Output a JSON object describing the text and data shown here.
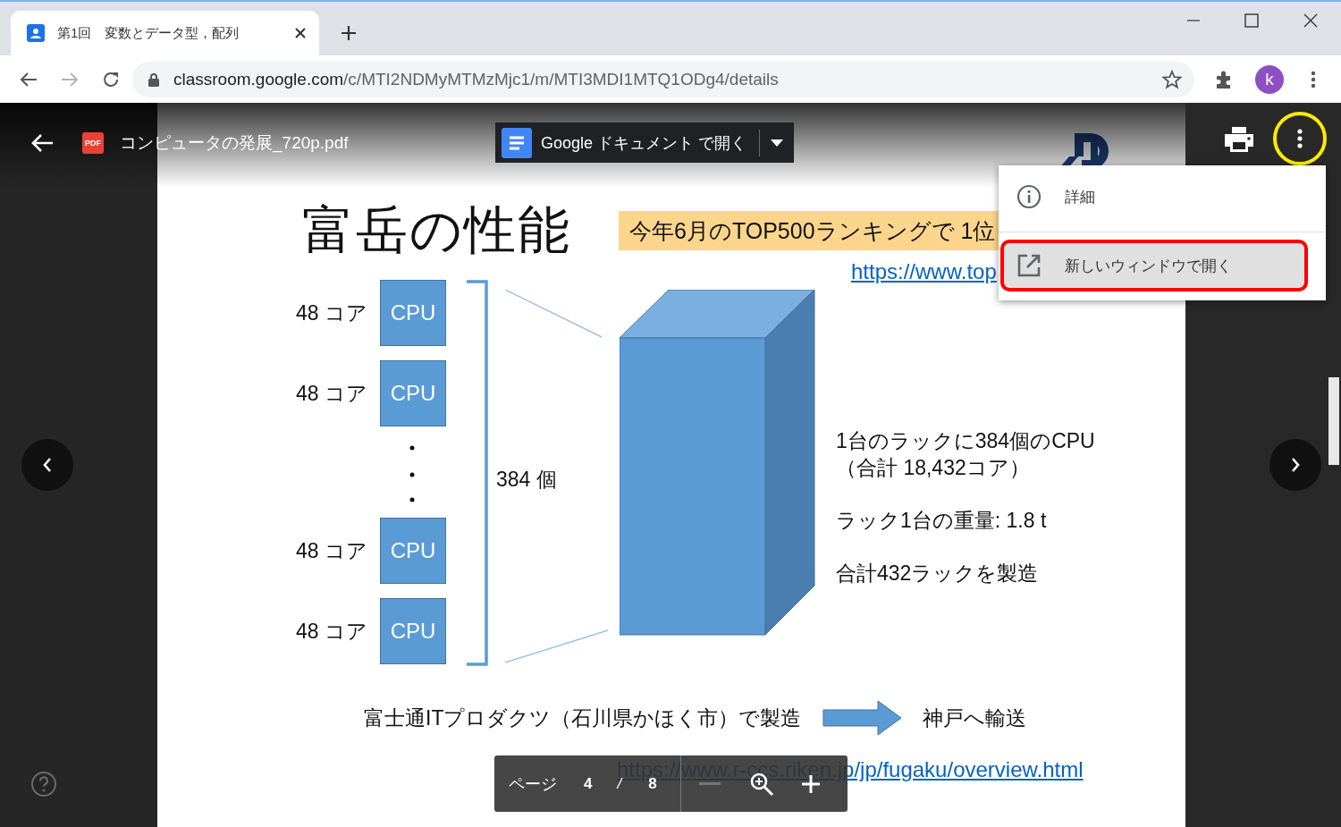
{
  "browser": {
    "tab": {
      "title": "第1回　変数とデータ型，配列",
      "selected": true
    },
    "url": {
      "host": "classroom.google.com",
      "path": "/c/MTI2NDMyMTMzMjc1/m/MTI3MDI1MTQ1ODg4/details"
    },
    "forward_disabled": true,
    "avatar": "k"
  },
  "viewer": {
    "file_badge": "PDF",
    "file_title": "コンピュータの発展_720p.pdf",
    "open_with": "Google ドキュメント で開く",
    "more_highlighted": true,
    "menu": [
      {
        "kind": "info",
        "label": "詳細",
        "selected": false,
        "highlighted": false
      },
      {
        "kind": "open-new",
        "label": "新しいウィンドウで開く",
        "selected": true,
        "highlighted": true
      }
    ],
    "page": {
      "label": "ページ",
      "current": "4",
      "separator": "/",
      "total": "8"
    },
    "zoom_out_disabled": true
  },
  "slide": {
    "title": "富岳の性能",
    "banner": "今年6月のTOP500ランキングで 1位",
    "banner_link": "https://www.top",
    "column": [
      {
        "kind": "cpu",
        "cores": "48 コア",
        "label": "CPU"
      },
      {
        "kind": "cpu",
        "cores": "48 コア",
        "label": "CPU"
      },
      {
        "kind": "dots"
      },
      {
        "kind": "cpu",
        "cores": "48 コア",
        "label": "CPU"
      },
      {
        "kind": "cpu",
        "cores": "48 コア",
        "label": "CPU"
      }
    ],
    "count": "384 個",
    "facts": [
      {
        "lines": [
          "1台のラックに384個のCPU",
          "（合計 18,432コア）"
        ]
      },
      {
        "lines": [
          "ラック1台の重量: 1.8 t"
        ]
      },
      {
        "lines": [
          "合計432ラックを製造"
        ]
      }
    ],
    "origin": "富士通ITプロダクツ（石川県かほく市）で製造",
    "destination": "神戸へ輸送",
    "source_link": "https://www.r-ccs.riken.jp/jp/fugaku/overview.html"
  }
}
